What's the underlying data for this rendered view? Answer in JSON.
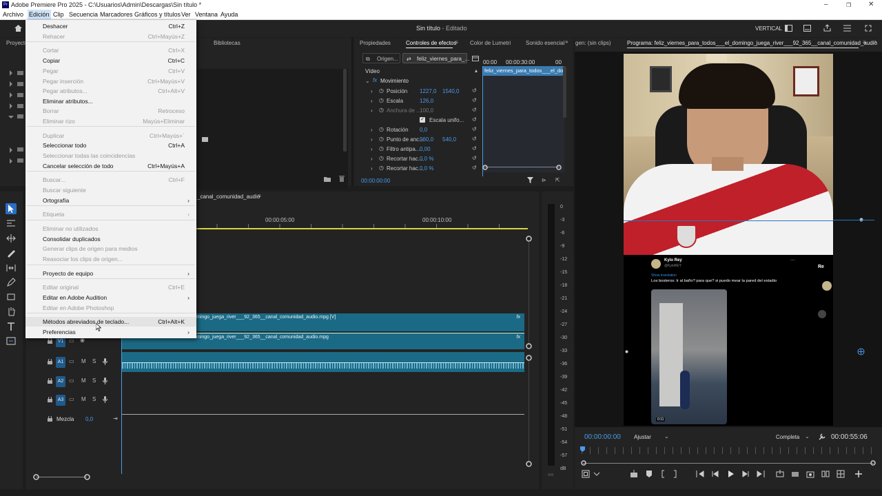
{
  "app": {
    "title": "Adobe Premiere Pro 2025 - C:\\Usuarios\\Admin\\Descargas\\Sin título *",
    "logo": "Pr"
  },
  "menubar": [
    "Archivo",
    "Edición",
    "Clip",
    "Secuencia",
    "Marcadores",
    "Gráficos y títulos",
    "Ver",
    "Ventana",
    "Ayuda"
  ],
  "header": {
    "project_title": "Sin título",
    "project_status": "- Editado",
    "vertical_label": "VERTICAL"
  },
  "edit_menu": {
    "items": [
      {
        "label": "Deshacer",
        "shortcut": "Ctrl+Z",
        "disabled": false
      },
      {
        "label": "Rehacer",
        "shortcut": "Ctrl+Mayús+Z",
        "disabled": true
      },
      {
        "label": "Cortar",
        "shortcut": "Ctrl+X",
        "disabled": true
      },
      {
        "label": "Copiar",
        "shortcut": "Ctrl+C",
        "disabled": false
      },
      {
        "label": "Pegar",
        "shortcut": "Ctrl+V",
        "disabled": true
      },
      {
        "label": "Pegar inserción",
        "shortcut": "Ctrl+Mayús+V",
        "disabled": true
      },
      {
        "label": "Pegar atributos...",
        "shortcut": "Ctrl+Alt+V",
        "disabled": true
      },
      {
        "label": "Eliminar atributos...",
        "shortcut": "",
        "disabled": false
      },
      {
        "label": "Borrar",
        "shortcut": "Retroceso",
        "disabled": true
      },
      {
        "label": "Eliminar rizo",
        "shortcut": "Mayús+Eliminar",
        "disabled": true
      },
      {
        "label": "Duplicar",
        "shortcut": "Ctrl+Mayús+`",
        "disabled": true
      },
      {
        "label": "Seleccionar todo",
        "shortcut": "Ctrl+A",
        "disabled": false
      },
      {
        "label": "Seleccionar todas las coincidencias",
        "shortcut": "",
        "disabled": true
      },
      {
        "label": "Cancelar selección de todo",
        "shortcut": "Ctrl+Mayús+A",
        "disabled": false
      },
      {
        "label": "Buscar...",
        "shortcut": "Ctrl+F",
        "disabled": true
      },
      {
        "label": "Buscar siguiente",
        "shortcut": "",
        "disabled": true
      },
      {
        "label": "Ortografía",
        "shortcut": "",
        "disabled": false,
        "submenu": true
      },
      {
        "label": "Etiqueta",
        "shortcut": "",
        "disabled": true,
        "submenu": true
      },
      {
        "label": "Eliminar no utilizados",
        "shortcut": "",
        "disabled": true
      },
      {
        "label": "Consolidar duplicados",
        "shortcut": "",
        "disabled": false
      },
      {
        "label": "Generar clips de origen para medios",
        "shortcut": "",
        "disabled": true
      },
      {
        "label": "Reasociar los clips de origen...",
        "shortcut": "",
        "disabled": true
      },
      {
        "label": "Proyecto de equipo",
        "shortcut": "",
        "disabled": false,
        "submenu": true
      },
      {
        "label": "Editar original",
        "shortcut": "Ctrl+E",
        "disabled": true
      },
      {
        "label": "Editar en Adobe Audition",
        "shortcut": "",
        "disabled": false,
        "submenu": true
      },
      {
        "label": "Editar en Adobe Photoshop",
        "shortcut": "",
        "disabled": true
      },
      {
        "label": "Métodos abreviados de teclado...",
        "shortcut": "Ctrl+Alt+K",
        "disabled": false,
        "highlighted": true
      },
      {
        "label": "Preferencias",
        "shortcut": "",
        "disabled": false,
        "submenu": true
      }
    ]
  },
  "project_panel": {
    "tab": "Proyecto",
    "libraries_tab": "Bibliotecas"
  },
  "effect_controls": {
    "tabs": [
      "Propiedades",
      "Controles de efectos",
      "Color de Lumetri",
      "Sonido esencial"
    ],
    "source_tab": "Origen...",
    "seq_tab": "feliz_viernes_para_...",
    "section": "Vídeo",
    "clip_name": "feliz_viernes_para_todos___el_do",
    "ruler": [
      "00:00",
      "00:00:30:00",
      "00"
    ],
    "group": "Movimiento",
    "props": [
      {
        "name": "Posición",
        "v1": "1227,0",
        "v2": "1540,0"
      },
      {
        "name": "Escala",
        "v1": "126,0",
        "v2": ""
      },
      {
        "name": "Anchura de ...",
        "v1": "100,0",
        "v2": ""
      },
      {
        "name": "Escala unifo...",
        "v1": "",
        "v2": ""
      },
      {
        "name": "Rotación",
        "v1": "0,0",
        "v2": ""
      },
      {
        "name": "Punto de anc...",
        "v1": "960,0",
        "v2": "540,0"
      },
      {
        "name": "Filtro antipa...",
        "v1": "0,00",
        "v2": ""
      },
      {
        "name": "Recortar hac...",
        "v1": "0,0 %",
        "v2": ""
      },
      {
        "name": "Recortar hac...",
        "v1": "0,0 %",
        "v2": ""
      }
    ],
    "timecode": "00:00:00:00"
  },
  "program_monitor": {
    "source_label": "gen: (sin clips)",
    "title": "Programa: feliz_viernes_para_todos___el_domingo_juega_river___92_365__canal_comunidad_audio",
    "timecode_left": "00:00:00:00",
    "fit_option": "Ajustar",
    "quality_option": "Completa",
    "timecode_right": "00:00:55:06"
  },
  "tweet": {
    "name": "Kylo Rey",
    "handle": "@KyloREY",
    "show_translation": "Show translation",
    "text": "Los bosteros: Ir al baño? para que? si puedo mear la pared del estadio",
    "video_time": "0:11",
    "side_initial": "Re"
  },
  "timeline": {
    "seq_tab": "_canal_comunidad_audio",
    "ruler": [
      "00:00:05:00",
      "00:00:10:00"
    ],
    "clip_v2": "mingo_juega_river___92_365__canal_comunidad_audio.mpg [V]",
    "clip_v1": "mingo_juega_river___92_365__canal_comunidad_audio.mpg",
    "fx": "fx",
    "tracks": [
      {
        "name": "V1",
        "m": "",
        "s": ""
      },
      {
        "name": "A1",
        "m": "M",
        "s": "S"
      },
      {
        "name": "A2",
        "m": "M",
        "s": "S"
      },
      {
        "name": "A3",
        "m": "M",
        "s": "S"
      }
    ],
    "mix_label": "Mezcla",
    "mix_value": "0,0"
  },
  "audio_meter": {
    "scale": [
      "0",
      "-3",
      "-6",
      "-9",
      "-12",
      "-15",
      "-18",
      "-21",
      "-24",
      "-27",
      "-30",
      "-33",
      "-36",
      "-39",
      "-42",
      "-45",
      "-48",
      "-51",
      "-54",
      "-57",
      "dB"
    ]
  },
  "colors": {
    "accent": "#4a9bea",
    "clip": "#1b6a85",
    "track_label": "#1f5a8a",
    "playhead": "#4a9bea",
    "workarea": "#d6d640"
  }
}
